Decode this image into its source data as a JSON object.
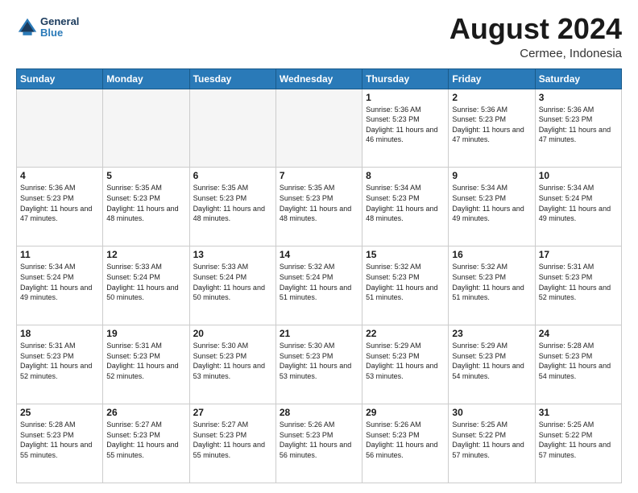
{
  "header": {
    "logo_line1": "General",
    "logo_line2": "Blue",
    "month_title": "August 2024",
    "location": "Cermee, Indonesia"
  },
  "calendar": {
    "days_of_week": [
      "Sunday",
      "Monday",
      "Tuesday",
      "Wednesday",
      "Thursday",
      "Friday",
      "Saturday"
    ],
    "weeks": [
      [
        {
          "day": "",
          "empty": true
        },
        {
          "day": "",
          "empty": true
        },
        {
          "day": "",
          "empty": true
        },
        {
          "day": "",
          "empty": true
        },
        {
          "day": "1",
          "sunrise": "5:36 AM",
          "sunset": "5:23 PM",
          "daylight": "11 hours and 46 minutes."
        },
        {
          "day": "2",
          "sunrise": "5:36 AM",
          "sunset": "5:23 PM",
          "daylight": "11 hours and 47 minutes."
        },
        {
          "day": "3",
          "sunrise": "5:36 AM",
          "sunset": "5:23 PM",
          "daylight": "11 hours and 47 minutes."
        }
      ],
      [
        {
          "day": "4",
          "sunrise": "5:36 AM",
          "sunset": "5:23 PM",
          "daylight": "11 hours and 47 minutes."
        },
        {
          "day": "5",
          "sunrise": "5:35 AM",
          "sunset": "5:23 PM",
          "daylight": "11 hours and 48 minutes."
        },
        {
          "day": "6",
          "sunrise": "5:35 AM",
          "sunset": "5:23 PM",
          "daylight": "11 hours and 48 minutes."
        },
        {
          "day": "7",
          "sunrise": "5:35 AM",
          "sunset": "5:23 PM",
          "daylight": "11 hours and 48 minutes."
        },
        {
          "day": "8",
          "sunrise": "5:34 AM",
          "sunset": "5:23 PM",
          "daylight": "11 hours and 48 minutes."
        },
        {
          "day": "9",
          "sunrise": "5:34 AM",
          "sunset": "5:23 PM",
          "daylight": "11 hours and 49 minutes."
        },
        {
          "day": "10",
          "sunrise": "5:34 AM",
          "sunset": "5:24 PM",
          "daylight": "11 hours and 49 minutes."
        }
      ],
      [
        {
          "day": "11",
          "sunrise": "5:34 AM",
          "sunset": "5:24 PM",
          "daylight": "11 hours and 49 minutes."
        },
        {
          "day": "12",
          "sunrise": "5:33 AM",
          "sunset": "5:24 PM",
          "daylight": "11 hours and 50 minutes."
        },
        {
          "day": "13",
          "sunrise": "5:33 AM",
          "sunset": "5:24 PM",
          "daylight": "11 hours and 50 minutes."
        },
        {
          "day": "14",
          "sunrise": "5:32 AM",
          "sunset": "5:24 PM",
          "daylight": "11 hours and 51 minutes."
        },
        {
          "day": "15",
          "sunrise": "5:32 AM",
          "sunset": "5:23 PM",
          "daylight": "11 hours and 51 minutes."
        },
        {
          "day": "16",
          "sunrise": "5:32 AM",
          "sunset": "5:23 PM",
          "daylight": "11 hours and 51 minutes."
        },
        {
          "day": "17",
          "sunrise": "5:31 AM",
          "sunset": "5:23 PM",
          "daylight": "11 hours and 52 minutes."
        }
      ],
      [
        {
          "day": "18",
          "sunrise": "5:31 AM",
          "sunset": "5:23 PM",
          "daylight": "11 hours and 52 minutes."
        },
        {
          "day": "19",
          "sunrise": "5:31 AM",
          "sunset": "5:23 PM",
          "daylight": "11 hours and 52 minutes."
        },
        {
          "day": "20",
          "sunrise": "5:30 AM",
          "sunset": "5:23 PM",
          "daylight": "11 hours and 53 minutes."
        },
        {
          "day": "21",
          "sunrise": "5:30 AM",
          "sunset": "5:23 PM",
          "daylight": "11 hours and 53 minutes."
        },
        {
          "day": "22",
          "sunrise": "5:29 AM",
          "sunset": "5:23 PM",
          "daylight": "11 hours and 53 minutes."
        },
        {
          "day": "23",
          "sunrise": "5:29 AM",
          "sunset": "5:23 PM",
          "daylight": "11 hours and 54 minutes."
        },
        {
          "day": "24",
          "sunrise": "5:28 AM",
          "sunset": "5:23 PM",
          "daylight": "11 hours and 54 minutes."
        }
      ],
      [
        {
          "day": "25",
          "sunrise": "5:28 AM",
          "sunset": "5:23 PM",
          "daylight": "11 hours and 55 minutes."
        },
        {
          "day": "26",
          "sunrise": "5:27 AM",
          "sunset": "5:23 PM",
          "daylight": "11 hours and 55 minutes."
        },
        {
          "day": "27",
          "sunrise": "5:27 AM",
          "sunset": "5:23 PM",
          "daylight": "11 hours and 55 minutes."
        },
        {
          "day": "28",
          "sunrise": "5:26 AM",
          "sunset": "5:23 PM",
          "daylight": "11 hours and 56 minutes."
        },
        {
          "day": "29",
          "sunrise": "5:26 AM",
          "sunset": "5:23 PM",
          "daylight": "11 hours and 56 minutes."
        },
        {
          "day": "30",
          "sunrise": "5:25 AM",
          "sunset": "5:22 PM",
          "daylight": "11 hours and 57 minutes."
        },
        {
          "day": "31",
          "sunrise": "5:25 AM",
          "sunset": "5:22 PM",
          "daylight": "11 hours and 57 minutes."
        }
      ]
    ],
    "labels": {
      "sunrise": "Sunrise:",
      "sunset": "Sunset:",
      "daylight": "Daylight:"
    }
  }
}
